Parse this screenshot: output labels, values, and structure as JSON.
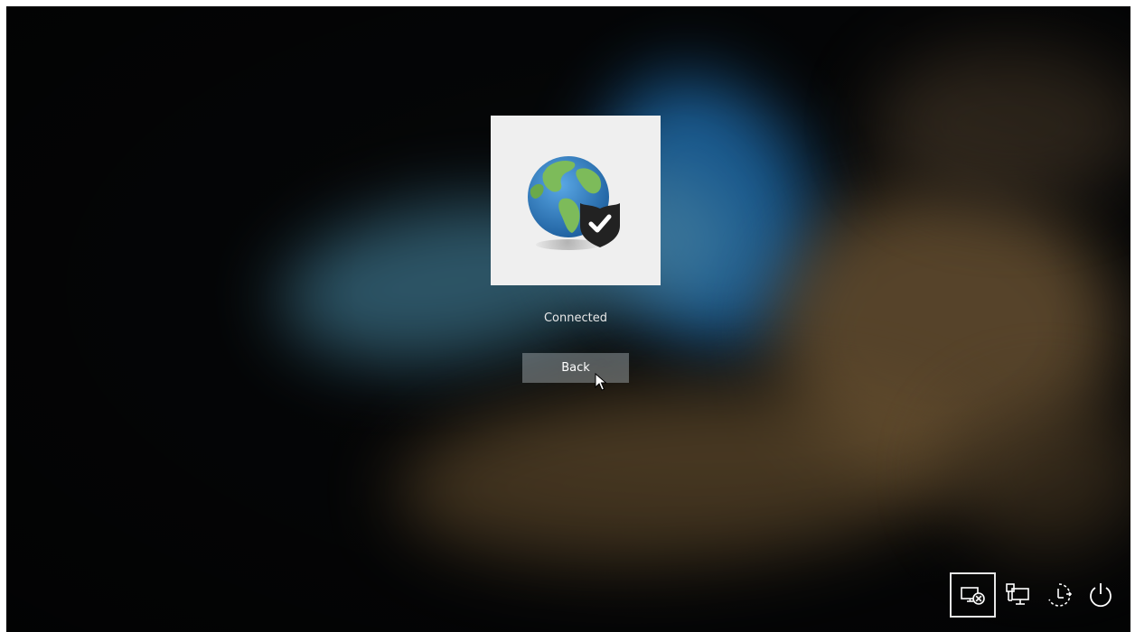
{
  "login_screen": {
    "tile_icon": "globe-shield-check-icon",
    "status_text": "Connected",
    "back_label": "Back"
  },
  "tray": {
    "icons": [
      "network-disconnect-icon",
      "network-icon",
      "accessibility-icon",
      "power-icon"
    ],
    "selected": "network-disconnect-icon"
  },
  "colors": {
    "tile_background": "#efefef",
    "button_background": "#8c969b",
    "shield": "#222222",
    "background": "#050607"
  }
}
